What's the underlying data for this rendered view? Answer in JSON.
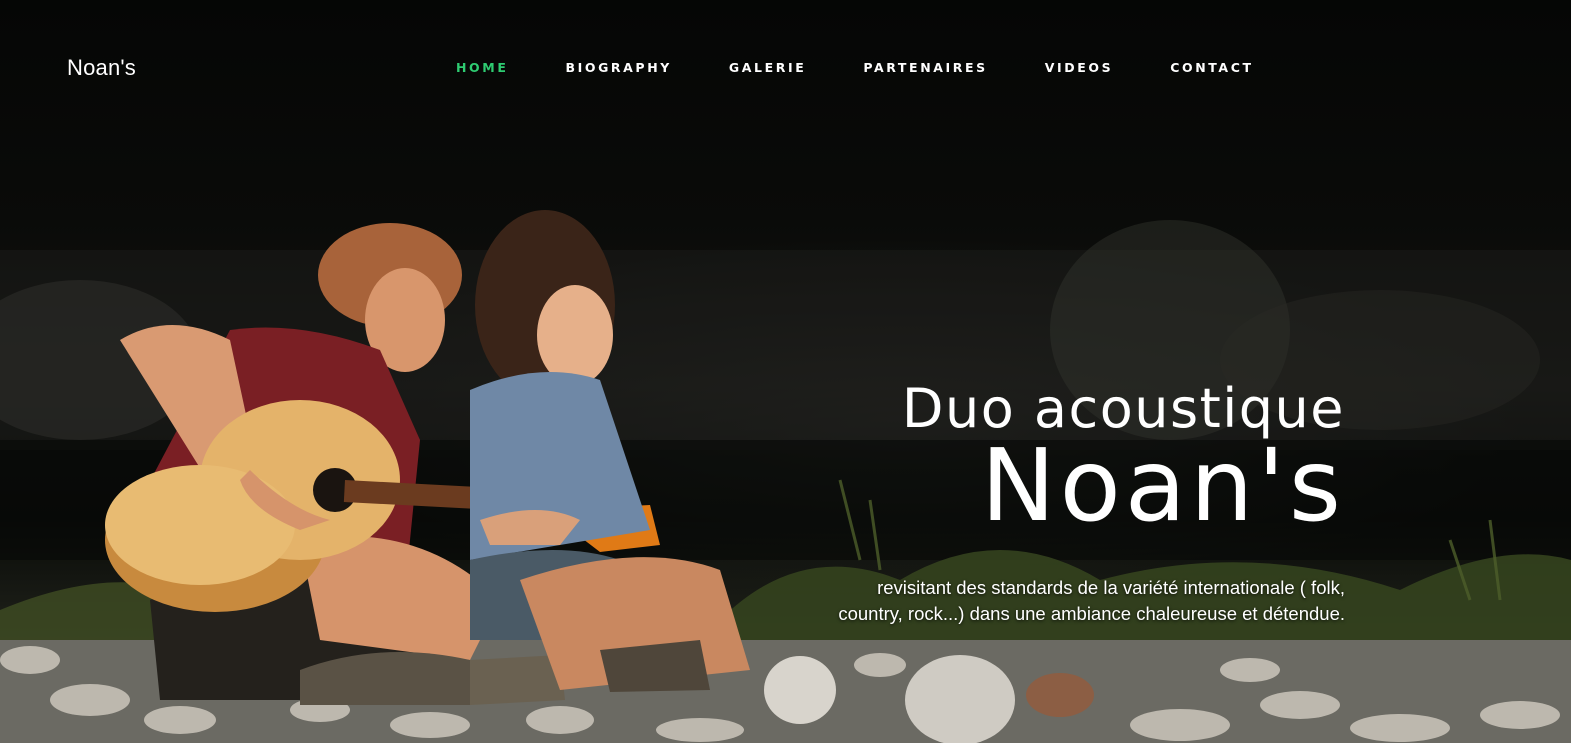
{
  "site": {
    "logo": "Noan's"
  },
  "nav": {
    "items": [
      {
        "label": "HOME",
        "active": true
      },
      {
        "label": "BIOGRAPHY",
        "active": false
      },
      {
        "label": "GALERIE",
        "active": false
      },
      {
        "label": "PARTENAIRES",
        "active": false
      },
      {
        "label": "VIDEOS",
        "active": false
      },
      {
        "label": "CONTACT",
        "active": false
      }
    ],
    "active_color": "#2ecc71"
  },
  "hero": {
    "heading_line1": "Duo acoustique",
    "heading_line2": "Noan's",
    "tagline_line1": "revisitant des standards de la variété internationale ( folk,",
    "tagline_line2": "country, rock...) dans une ambiance chaleureuse et détendue."
  }
}
